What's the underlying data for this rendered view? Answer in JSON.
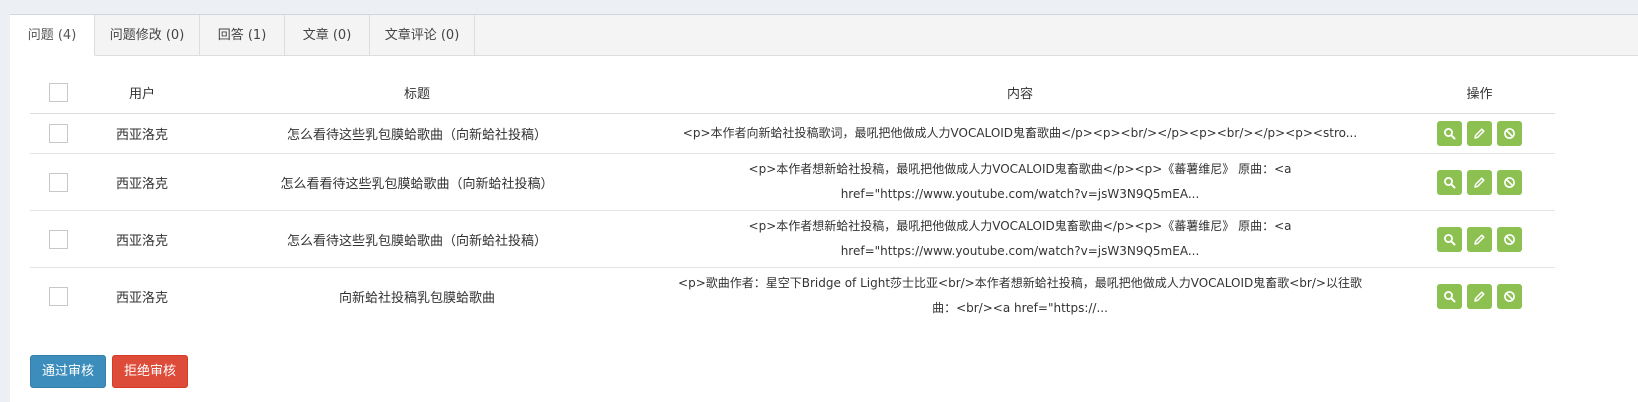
{
  "tabs": [
    {
      "label": "问题 (4)"
    },
    {
      "label": "问题修改 (0)"
    },
    {
      "label": "回答 (1)"
    },
    {
      "label": "文章 (0)"
    },
    {
      "label": "文章评论 (0)"
    }
  ],
  "table": {
    "headers": {
      "user": "用户",
      "title": "标题",
      "content": "内容",
      "actions": "操作"
    },
    "rows": [
      {
        "user": "西亚洛克",
        "title": "怎么看待这些乳包膜蛤歌曲（向新蛤社投稿）",
        "content_line1": "<p>本作者向新蛤社投稿歌词，最吼把他做成人力VOCALOID鬼畜歌曲</p><p><br/></p><p><br/></p><p><stro...",
        "content_line2": ""
      },
      {
        "user": "西亚洛克",
        "title": "怎么看看待这些乳包膜蛤歌曲（向新蛤社投稿）",
        "content_line1": "<p>本作者想新蛤社投稿，最吼把他做成人力VOCALOID鬼畜歌曲</p><p>《蕃薯维尼》 原曲：<a",
        "content_line2": "href=\"https://www.youtube.com/watch?v=jsW3N9Q5mEA..."
      },
      {
        "user": "西亚洛克",
        "title": "怎么看待这些乳包膜蛤歌曲（向新蛤社投稿）",
        "content_line1": "<p>本作者想新蛤社投稿，最吼把他做成人力VOCALOID鬼畜歌曲</p><p>《蕃薯维尼》 原曲：<a",
        "content_line2": "href=\"https://www.youtube.com/watch?v=jsW3N9Q5mEA..."
      },
      {
        "user": "西亚洛克",
        "title": "向新蛤社投稿乳包膜蛤歌曲",
        "content_line1": "<p>歌曲作者：星空下Bridge of Light莎士比亚<br/>本作者想新蛤社投稿，最吼把他做成人力VOCALOID鬼畜歌<br/>以往歌",
        "content_line2": "曲：<br/><a href=\"https://..."
      }
    ]
  },
  "buttons": {
    "approve": "通过审核",
    "reject": "拒绝审核"
  },
  "colors": {
    "action_green": "#8cc152",
    "approve_blue": "#3c8dbc",
    "reject_red": "#dd4b39"
  },
  "icons": {
    "view": "search-icon",
    "edit": "pencil-icon",
    "reject": "ban-icon"
  }
}
